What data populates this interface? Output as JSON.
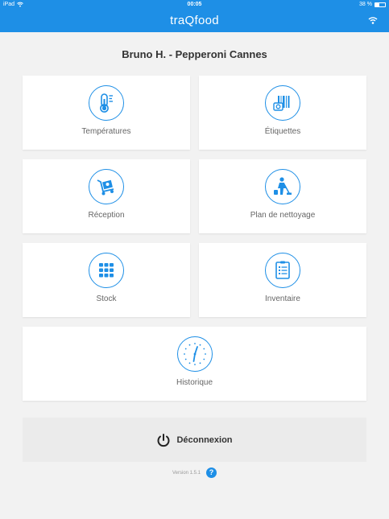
{
  "status_bar": {
    "device": "iPad",
    "time": "00:05",
    "battery": "38 %"
  },
  "app": {
    "brand": "traQfood"
  },
  "user": {
    "title": "Bruno H. - Pepperoni Cannes"
  },
  "tiles": [
    {
      "label": "Températures",
      "icon": "thermometer-icon"
    },
    {
      "label": "Étiquettes",
      "icon": "barcode-camera-icon"
    },
    {
      "label": "Réception",
      "icon": "delivery-trolley-icon"
    },
    {
      "label": "Plan de nettoyage",
      "icon": "cleaning-person-icon"
    },
    {
      "label": "Stock",
      "icon": "stock-grid-icon"
    },
    {
      "label": "Inventaire",
      "icon": "checklist-icon"
    },
    {
      "label": "Historique",
      "icon": "clock-icon"
    }
  ],
  "logout": {
    "label": "Déconnexion"
  },
  "footer": {
    "version": "Version 1.5.1",
    "help": "?"
  },
  "colors": {
    "primary": "#1e8fe6",
    "background": "#f2f2f2",
    "tile": "#ffffff"
  }
}
